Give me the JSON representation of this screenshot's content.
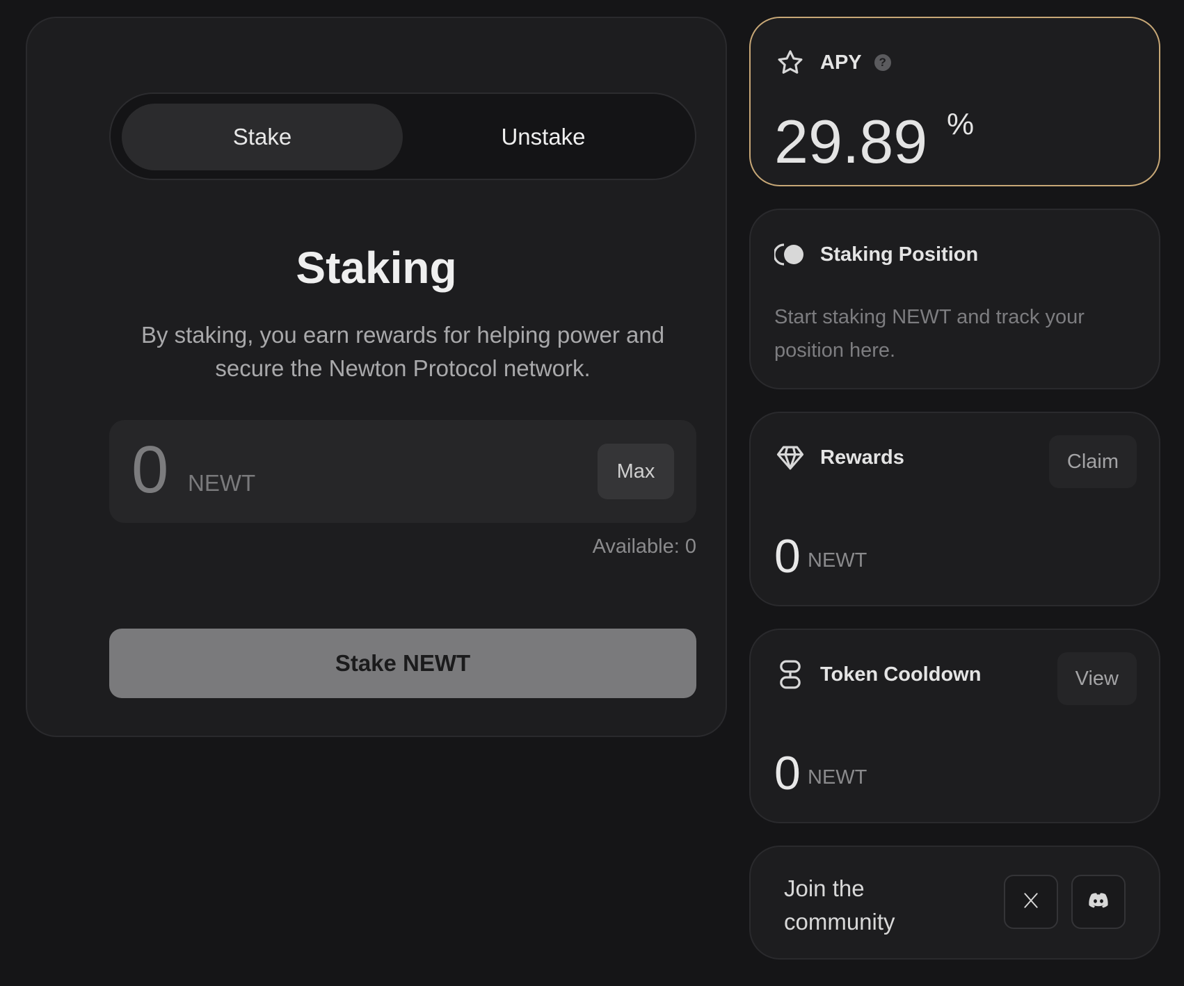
{
  "staking_panel": {
    "tabs": [
      {
        "label": "Stake",
        "active": true
      },
      {
        "label": "Unstake",
        "active": false
      }
    ],
    "title": "Staking",
    "description": "By staking, you earn rewards for helping power and secure the Newton Protocol network.",
    "amount_input": {
      "value": "0",
      "unit": "NEWT",
      "max_label": "Max"
    },
    "available": "Available: 0",
    "submit_label": "Stake NEWT"
  },
  "apy_card": {
    "icon": "star-icon",
    "title": "APY",
    "help_icon": "?",
    "value": "29.89",
    "unit": "%",
    "border_color": "#c8a877"
  },
  "position_card": {
    "icon": "half-moon-icon",
    "title": "Staking Position",
    "text": "Start staking NEWT and track your position here."
  },
  "rewards_card": {
    "icon": "diamond-icon",
    "title": "Rewards",
    "action_label": "Claim",
    "value": "0",
    "unit": "NEWT"
  },
  "cooldown_card": {
    "icon": "hourglass-icon",
    "title": "Token Cooldown",
    "action_label": "View",
    "value": "0",
    "unit": "NEWT"
  },
  "community_card": {
    "text": "Join the community",
    "links": [
      {
        "icon": "x-icon"
      },
      {
        "icon": "discord-icon"
      }
    ]
  }
}
